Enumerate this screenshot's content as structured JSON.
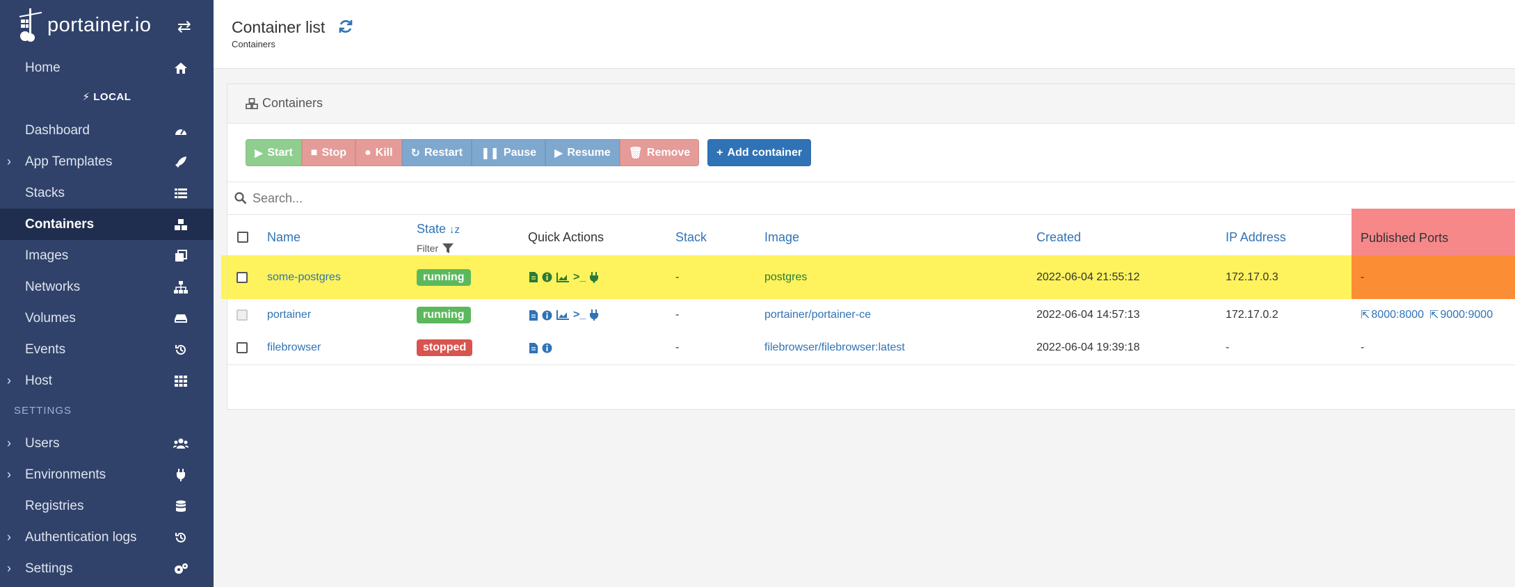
{
  "colors": {
    "sidebar_bg": "#30426a",
    "sidebar_active": "#1f2d4e",
    "link": "#2f73b6",
    "running": "#5cb85c",
    "stopped": "#d9534f",
    "highlight_row": "#fef35c",
    "highlight_ports_header": "#f7888a",
    "highlight_ports_cell": "#fb8e34"
  },
  "sidebar": {
    "brand": "portainer.io",
    "toggle_icon": "exchange-icon",
    "home": {
      "label": "Home",
      "icon": "home-icon"
    },
    "environment": "LOCAL",
    "items": [
      {
        "label": "Dashboard",
        "icon": "tachometer-icon",
        "expandable": false
      },
      {
        "label": "App Templates",
        "icon": "rocket-icon",
        "expandable": true
      },
      {
        "label": "Stacks",
        "icon": "th-list-icon",
        "expandable": false
      },
      {
        "label": "Containers",
        "icon": "cubes-icon",
        "expandable": false,
        "active": true
      },
      {
        "label": "Images",
        "icon": "clone-icon",
        "expandable": false
      },
      {
        "label": "Networks",
        "icon": "sitemap-icon",
        "expandable": false
      },
      {
        "label": "Volumes",
        "icon": "hdd-icon",
        "expandable": false
      },
      {
        "label": "Events",
        "icon": "history-icon",
        "expandable": false
      },
      {
        "label": "Host",
        "icon": "th-icon",
        "expandable": true
      }
    ],
    "settings_section": "SETTINGS",
    "settings_items": [
      {
        "label": "Users",
        "icon": "users-icon",
        "expandable": true
      },
      {
        "label": "Environments",
        "icon": "plug-icon",
        "expandable": true
      },
      {
        "label": "Registries",
        "icon": "database-icon",
        "expandable": false
      },
      {
        "label": "Authentication logs",
        "icon": "history-icon",
        "expandable": true
      },
      {
        "label": "Settings",
        "icon": "cogs-icon",
        "expandable": true
      }
    ]
  },
  "header": {
    "title": "Container list",
    "breadcrumb": "Containers"
  },
  "widget": {
    "title": "Containers",
    "toolbar": {
      "start": "Start",
      "stop": "Stop",
      "kill": "Kill",
      "restart": "Restart",
      "pause": "Pause",
      "resume": "Resume",
      "remove": "Remove",
      "add": "Add container"
    },
    "search_placeholder": "Search...",
    "columns": {
      "name": "Name",
      "state": "State",
      "filter": "Filter",
      "quick_actions": "Quick Actions",
      "stack": "Stack",
      "image": "Image",
      "created": "Created",
      "ip": "IP Address",
      "ports": "Published Ports"
    },
    "rows": [
      {
        "name": "some-postgres",
        "state": "running",
        "stack": "-",
        "image": "postgres",
        "created": "2022-06-04 21:55:12",
        "ip": "172.17.0.3",
        "ports": "-",
        "quick_actions": [
          "file-icon",
          "info-icon",
          "chart-icon",
          "terminal-icon",
          "plug-icon"
        ]
      },
      {
        "name": "portainer",
        "state": "running",
        "stack": "-",
        "image": "portainer/portainer-ce",
        "created": "2022-06-04 14:57:13",
        "ip": "172.17.0.2",
        "port_links": [
          "8000:8000",
          "9000:9000"
        ],
        "quick_actions": [
          "file-icon",
          "info-icon",
          "chart-icon",
          "terminal-icon",
          "plug-icon"
        ]
      },
      {
        "name": "filebrowser",
        "state": "stopped",
        "stack": "-",
        "image": "filebrowser/filebrowser:latest",
        "created": "2022-06-04 19:39:18",
        "ip": "-",
        "ports": "-",
        "quick_actions": [
          "file-icon",
          "info-icon"
        ]
      }
    ]
  }
}
